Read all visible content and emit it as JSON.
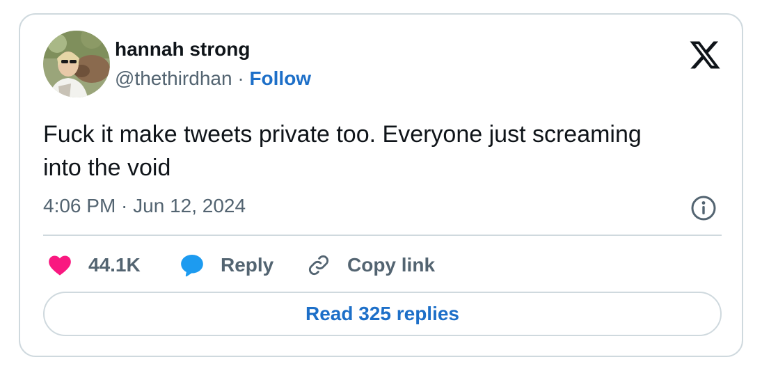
{
  "author": {
    "name": "hannah strong",
    "handle": "@thethirdhan",
    "separator": " · ",
    "follow_label": "Follow"
  },
  "tweet": {
    "text": "Fuck it make tweets private too. Everyone just screaming into the void",
    "timestamp": "4:06 PM · Jun 12, 2024"
  },
  "actions": {
    "likes": "44.1K",
    "reply_label": "Reply",
    "copy_link_label": "Copy link"
  },
  "read_replies_label": "Read 325 replies",
  "colors": {
    "text": "#0f1419",
    "muted": "#536471",
    "link": "#1d6fc8",
    "like": "#f91880",
    "reply_bubble": "#1d9bf0",
    "border": "#cfd9de"
  },
  "icons": {
    "logo": "x-logo-icon",
    "info": "info-icon",
    "like": "heart-icon",
    "reply": "speech-bubble-icon",
    "copy": "link-icon"
  }
}
